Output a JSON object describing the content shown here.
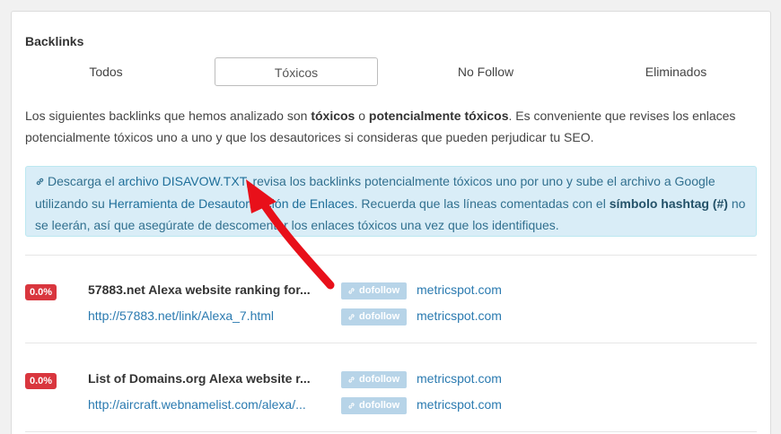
{
  "panel": {
    "title": "Backlinks"
  },
  "tabs": [
    {
      "label": "Todos"
    },
    {
      "label": "Tóxicos"
    },
    {
      "label": "No Follow"
    },
    {
      "label": "Eliminados"
    }
  ],
  "intro": {
    "t1": "Los siguientes backlinks que hemos analizado son ",
    "b1": "tóxicos",
    "t2": " o ",
    "b2": "potencialmente tóxicos",
    "t3": ". Es conveniente que revises los enlaces potencialmente tóxicos uno a uno y que los desautorices si consideras que pueden perjudicar tu SEO."
  },
  "info": {
    "t1": "Descarga el ",
    "link1": "archivo DISAVOW.TXT",
    "t2": ", revisa los backlinks potencialmente tóxicos uno por uno y sube el archivo a Google utilizando su ",
    "link2": "Herramienta de Desautorización de Enlaces",
    "t3": ". Recuerda que las líneas comentadas con el ",
    "b1": "símbolo hashtag (#)",
    "t4": " no se leerán, así que asegúrate de descomentar los enlaces tóxicos una vez que los identifiques."
  },
  "backlinks": [
    {
      "score": "0.0%",
      "title": "57883.net Alexa website ranking for...",
      "url": "http://57883.net/link/Alexa_7.html",
      "tag1": "dofollow",
      "domain1": "metricspot.com",
      "tag2": "dofollow",
      "domain2": "metricspot.com"
    },
    {
      "score": "0.0%",
      "title": "List of Domains.org Alexa website r...",
      "url": "http://aircraft.webnamelist.com/alexa/...",
      "tag1": "dofollow",
      "domain1": "metricspot.com",
      "tag2": "dofollow",
      "domain2": "metricspot.com"
    }
  ],
  "colors": {
    "score_badge": "#d9363e",
    "tag_bg": "#b7d4e8",
    "link": "#2a7ab0",
    "info_bg": "#d9edf7",
    "annotation_arrow": "#e8101a"
  },
  "icons": {
    "link": "link-icon",
    "annotation": "red-arrow-annotation"
  }
}
